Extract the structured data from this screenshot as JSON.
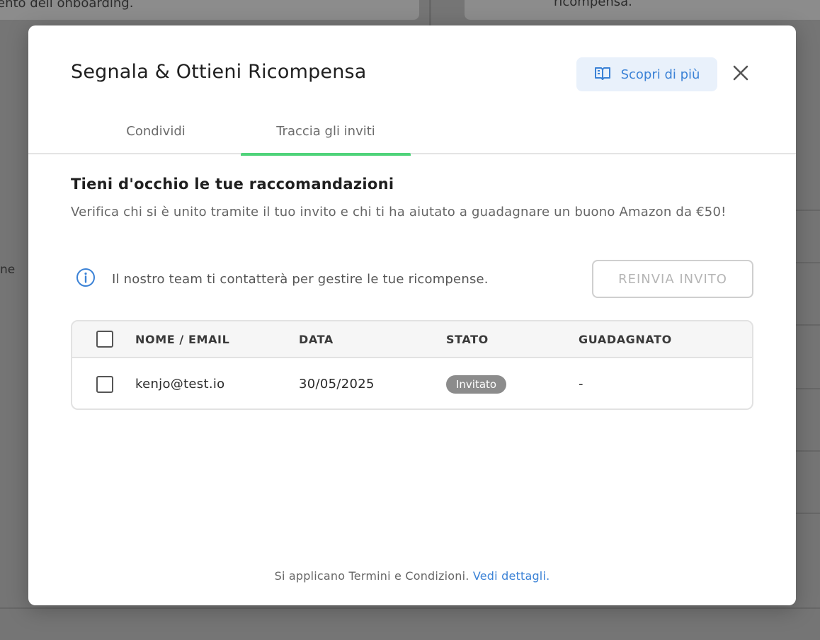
{
  "background": {
    "fragment_left": "ento dell onboarding.",
    "fragment_right": "ricompensa.",
    "fragment_side": "ne"
  },
  "modal": {
    "title": "Segnala & Ottieni Ricompensa",
    "learn_more_label": "Scopri di più",
    "tabs": [
      {
        "label": "Condividi",
        "active": false
      },
      {
        "label": "Traccia gli inviti",
        "active": true
      }
    ],
    "section_title": "Tieni d'occhio le tue raccomandazioni",
    "section_desc": "Verifica chi si è unito tramite il tuo invito e chi ti ha aiutato a guadagnare un buono Amazon da €50!",
    "info_text": "Il nostro team ti contatterà per gestire le tue ricompense.",
    "resend_label": "REINVIA INVITO",
    "table": {
      "headers": [
        "NOME / EMAIL",
        "DATA",
        "STATO",
        "GUADAGNATO"
      ],
      "rows": [
        {
          "email": "kenjo@test.io",
          "date": "30/05/2025",
          "status": "Invitato",
          "earned": "-"
        }
      ]
    },
    "footer_text": "Si applicano Termini e Condizioni.",
    "footer_link": "Vedi dettagli."
  },
  "colors": {
    "accent_blue": "#3b82d6",
    "tab_indicator": "#4fd37a",
    "badge_gray": "#8c8c8c"
  }
}
